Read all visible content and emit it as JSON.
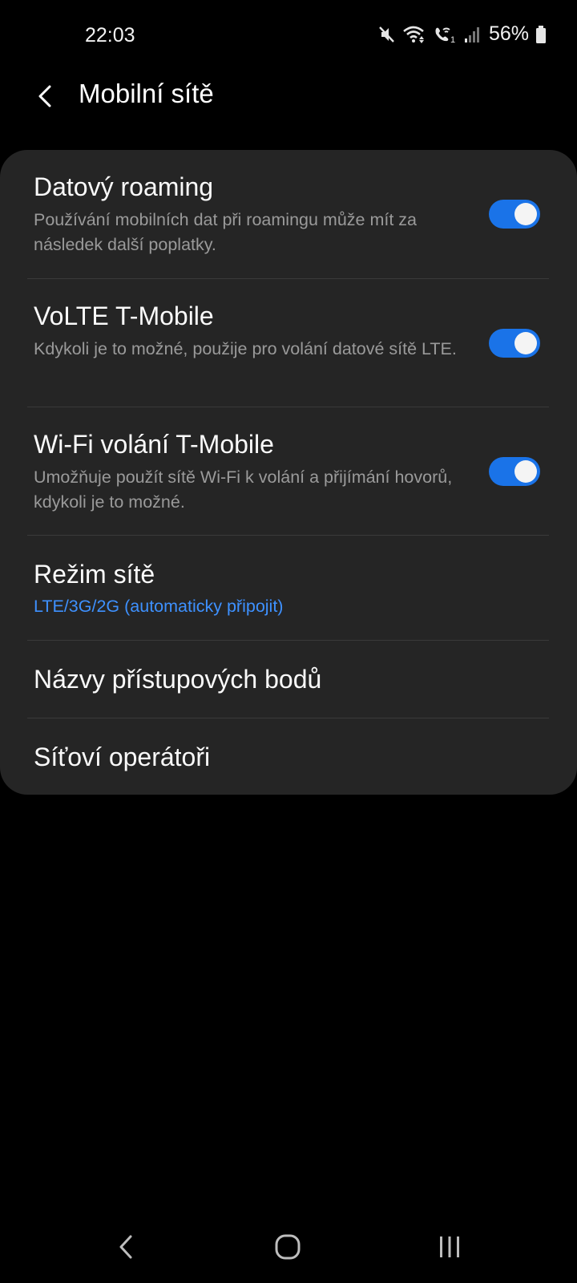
{
  "status_bar": {
    "time": "22:03",
    "battery_percent": "56%",
    "icons": [
      "mute-icon",
      "wifi-icon",
      "wifi-calling-icon",
      "signal-icon",
      "battery-icon"
    ]
  },
  "header": {
    "title": "Mobilní sítě"
  },
  "settings": [
    {
      "title": "Datový roaming",
      "description": "Používání mobilních dat při roamingu může mít za následek další poplatky.",
      "toggle": true
    },
    {
      "title": "VoLTE T-Mobile",
      "description": "Kdykoli je to možné, použije pro volání datové sítě LTE.",
      "toggle": true
    },
    {
      "title": "Wi-Fi volání T-Mobile",
      "description": "Umožňuje použít sítě Wi-Fi k volání a přijímání hovorů, kdykoli je to možné.",
      "toggle": true
    },
    {
      "title": "Režim sítě",
      "value": "LTE/3G/2G (automaticky připojit)"
    },
    {
      "title": "Názvy přístupových bodů"
    },
    {
      "title": "Síťoví operátoři"
    }
  ],
  "colors": {
    "accent": "#3e91ff",
    "toggle_on": "#1a73e8",
    "card_bg": "#252525",
    "background": "#000000"
  }
}
